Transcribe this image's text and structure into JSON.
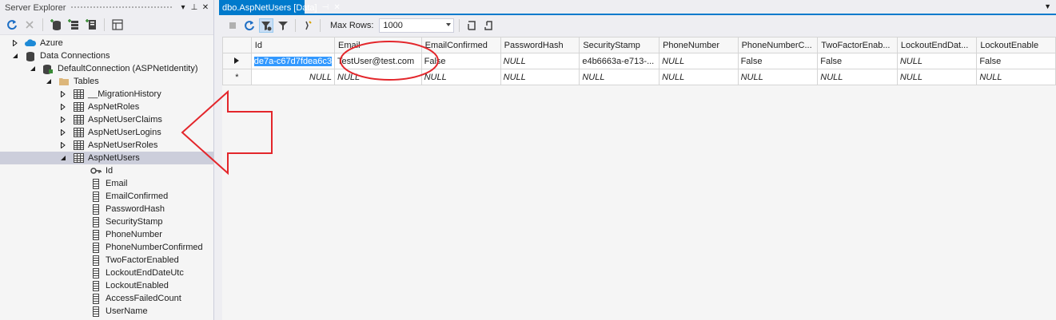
{
  "server_explorer": {
    "title": "Server Explorer",
    "title_buttons": [
      "▾",
      "⊥",
      "✕"
    ],
    "tree": [
      {
        "label": "Azure",
        "indent": 0,
        "expander": "collapsed",
        "icon": "azure-cloud-icon"
      },
      {
        "label": "Data Connections",
        "indent": 0,
        "expander": "expanded",
        "icon": "database-icon"
      },
      {
        "label": "DefaultConnection (ASPNetIdentity)",
        "indent": 1,
        "expander": "expanded",
        "icon": "connection-icon"
      },
      {
        "label": "Tables",
        "indent": 2,
        "expander": "expanded",
        "icon": "folder-icon"
      },
      {
        "label": "__MigrationHistory",
        "indent": 3,
        "expander": "collapsed",
        "icon": "table-icon"
      },
      {
        "label": "AspNetRoles",
        "indent": 3,
        "expander": "collapsed",
        "icon": "table-icon"
      },
      {
        "label": "AspNetUserClaims",
        "indent": 3,
        "expander": "collapsed",
        "icon": "table-icon"
      },
      {
        "label": "AspNetUserLogins",
        "indent": 3,
        "expander": "collapsed",
        "icon": "table-icon"
      },
      {
        "label": "AspNetUserRoles",
        "indent": 3,
        "expander": "collapsed",
        "icon": "table-icon"
      },
      {
        "label": "AspNetUsers",
        "indent": 3,
        "expander": "expanded",
        "icon": "table-icon",
        "selected": true
      },
      {
        "label": "Id",
        "indent": 4,
        "expander": "none",
        "icon": "key-icon"
      },
      {
        "label": "Email",
        "indent": 4,
        "expander": "none",
        "icon": "column-icon"
      },
      {
        "label": "EmailConfirmed",
        "indent": 4,
        "expander": "none",
        "icon": "column-icon"
      },
      {
        "label": "PasswordHash",
        "indent": 4,
        "expander": "none",
        "icon": "column-icon"
      },
      {
        "label": "SecurityStamp",
        "indent": 4,
        "expander": "none",
        "icon": "column-icon"
      },
      {
        "label": "PhoneNumber",
        "indent": 4,
        "expander": "none",
        "icon": "column-icon"
      },
      {
        "label": "PhoneNumberConfirmed",
        "indent": 4,
        "expander": "none",
        "icon": "column-icon"
      },
      {
        "label": "TwoFactorEnabled",
        "indent": 4,
        "expander": "none",
        "icon": "column-icon"
      },
      {
        "label": "LockoutEndDateUtc",
        "indent": 4,
        "expander": "none",
        "icon": "column-icon"
      },
      {
        "label": "LockoutEnabled",
        "indent": 4,
        "expander": "none",
        "icon": "column-icon"
      },
      {
        "label": "AccessFailedCount",
        "indent": 4,
        "expander": "none",
        "icon": "column-icon"
      },
      {
        "label": "UserName",
        "indent": 4,
        "expander": "none",
        "icon": "column-icon"
      }
    ]
  },
  "document_tab": {
    "title": "dbo.AspNetUsers [Data]",
    "pin": "⊣",
    "close": "✕"
  },
  "grid_toolbar": {
    "max_rows_label": "Max Rows:",
    "max_rows_value": "1000"
  },
  "data_grid": {
    "columns": [
      "Id",
      "Email",
      "EmailConfirmed",
      "PasswordHash",
      "SecurityStamp",
      "PhoneNumber",
      "PhoneNumberC...",
      "TwoFactorEnab...",
      "LockoutEndDat...",
      "LockoutEnable"
    ],
    "rows": [
      {
        "marker": "current",
        "cells": [
          "de7a-c67d7fdea6c3",
          "TestUser@test.com",
          "False",
          "NULL",
          "e4b6663a-e713-...",
          "NULL",
          "False",
          "False",
          "NULL",
          "False"
        ]
      },
      {
        "marker": "new",
        "cells": [
          "NULL",
          "NULL",
          "NULL",
          "NULL",
          "NULL",
          "NULL",
          "NULL",
          "NULL",
          "NULL",
          "NULL"
        ]
      }
    ]
  },
  "colors": {
    "accent": "#007acc",
    "annotation_red": "#e3262b",
    "selection": "#3399ff"
  }
}
